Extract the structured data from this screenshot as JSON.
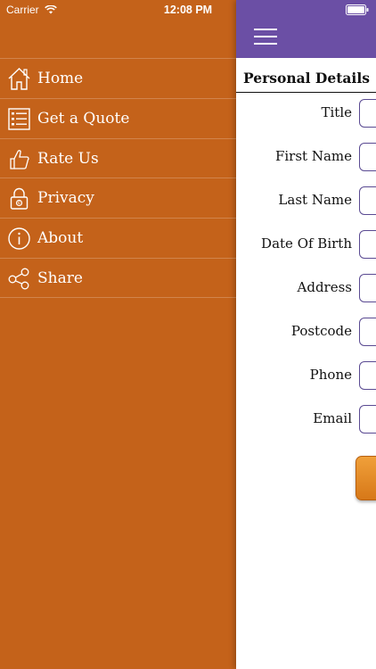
{
  "status_bar": {
    "carrier": "Carrier",
    "time": "12:08 PM"
  },
  "menu": {
    "items": [
      {
        "label": "Home",
        "icon": "home-icon"
      },
      {
        "label": "Get a Quote",
        "icon": "quote-list-icon"
      },
      {
        "label": "Rate Us",
        "icon": "thumbs-up-icon"
      },
      {
        "label": "Privacy",
        "icon": "lock-icon"
      },
      {
        "label": "About",
        "icon": "info-icon"
      },
      {
        "label": "Share",
        "icon": "share-icon"
      }
    ]
  },
  "form": {
    "title": "Personal Details",
    "fields": [
      {
        "label": "Title",
        "value": ""
      },
      {
        "label": "First Name",
        "value": ""
      },
      {
        "label": "Last Name",
        "value": ""
      },
      {
        "label": "Date Of Birth",
        "value": ""
      },
      {
        "label": "Address",
        "value": ""
      },
      {
        "label": "Postcode",
        "value": ""
      },
      {
        "label": "Phone",
        "value": ""
      },
      {
        "label": "Email",
        "value": ""
      }
    ]
  },
  "colors": {
    "menu_background": "#c4621a",
    "header_background": "#6b4fa5",
    "button_accent": "#e8902a"
  }
}
